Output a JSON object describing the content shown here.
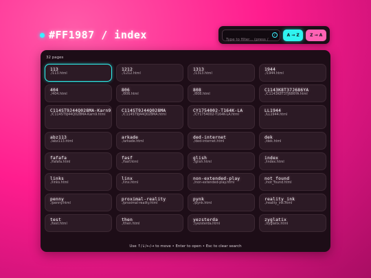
{
  "header": {
    "title": "#FF1987 / index"
  },
  "toolbar": {
    "search_placeholder": "Type to filter... (press /",
    "search_key": "/",
    "sort_az": "A → Z",
    "sort_za": "Z → A"
  },
  "panel": {
    "count": "32 pages",
    "hint": "Use ↑/↓/←/→ to move • Enter to open • Esc to clear search"
  },
  "pages": [
    {
      "name": "113",
      "path": "./113.html"
    },
    {
      "name": "1212",
      "path": "./1212.html"
    },
    {
      "name": "1313",
      "path": "./1313.html"
    },
    {
      "name": "1944",
      "path": "./1944.html"
    },
    {
      "name": "404",
      "path": "./404.html"
    },
    {
      "name": "806",
      "path": "./806.html"
    },
    {
      "name": "808",
      "path": "./808.html"
    },
    {
      "name": "C1143K8T37J686YA",
      "path": "./C1143K8T37J686YA.html"
    },
    {
      "name": "C114ST9J44Q028MA-Karn9",
      "path": "./C114ST9J44Q028MA-Karn9.html"
    },
    {
      "name": "C114ST9J44Q028MA",
      "path": "./C114ST9J44Q028MA.html"
    },
    {
      "name": "CY1754002-T164K-LA",
      "path": "./CY1754002-T164K-LA.html"
    },
    {
      "name": "LL1944",
      "path": "./LL1944.html"
    },
    {
      "name": "abz113",
      "path": "./abz113.html"
    },
    {
      "name": "arkade",
      "path": "./arkade.html"
    },
    {
      "name": "ded-internet",
      "path": "./ded-internet.html"
    },
    {
      "name": "dek",
      "path": "./dek.html"
    },
    {
      "name": "fafafa",
      "path": "./fafafa.html"
    },
    {
      "name": "fasf",
      "path": "./fasf.html"
    },
    {
      "name": "glish",
      "path": "./glish.html"
    },
    {
      "name": "index",
      "path": "./index.html"
    },
    {
      "name": "links",
      "path": "./links.html"
    },
    {
      "name": "linx",
      "path": "./linx.html"
    },
    {
      "name": "non-extended-play",
      "path": "./non-extended-play.html"
    },
    {
      "name": "not_found",
      "path": "./not_found.html"
    },
    {
      "name": "penny",
      "path": "./penny.html"
    },
    {
      "name": "proximal-reality",
      "path": "./proximal-reality.html"
    },
    {
      "name": "pynk",
      "path": "./pynk.html"
    },
    {
      "name": "reality_ink",
      "path": "./reality_ink.html"
    },
    {
      "name": "test",
      "path": "./test.html"
    },
    {
      "name": "then",
      "path": "./then.html"
    },
    {
      "name": "yezsterda",
      "path": "./yezsterda.html"
    },
    {
      "name": "zyglatix",
      "path": "./zyglatix.html"
    }
  ],
  "colors": {
    "accent_cyan": "#2ff4f0",
    "accent_pink": "#ff62b4",
    "background": "#ff1987",
    "panel": "#1d0d17"
  }
}
